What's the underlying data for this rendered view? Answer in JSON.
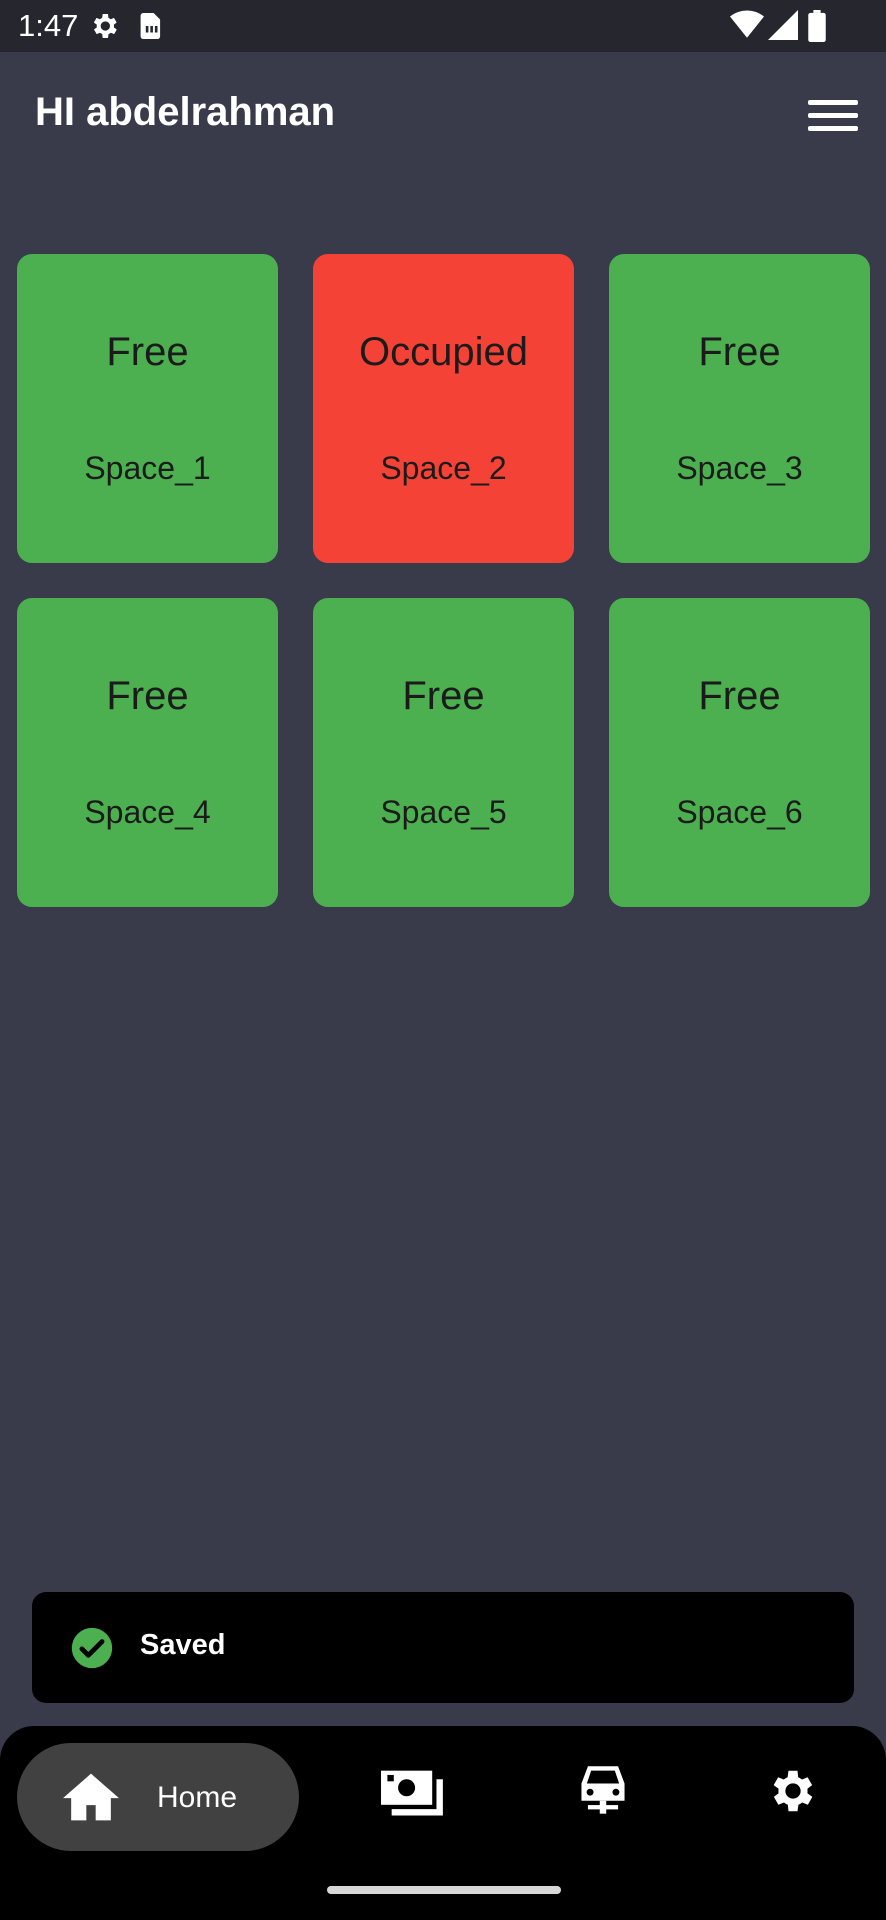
{
  "status_bar": {
    "time": "1:47",
    "icons": [
      "settings-gear-icon",
      "sim-card-icon",
      "wifi-icon",
      "cell-signal-icon",
      "battery-icon"
    ]
  },
  "header": {
    "greeting": "HI abdelrahman",
    "menu_icon": "hamburger-menu-icon"
  },
  "spaces": [
    {
      "status": "Free",
      "name": "Space_1",
      "color": "#4caf50"
    },
    {
      "status": "Occupied",
      "name": "Space_2",
      "color": "#f44336"
    },
    {
      "status": "Free",
      "name": "Space_3",
      "color": "#4caf50"
    },
    {
      "status": "Free",
      "name": "Space_4",
      "color": "#4caf50"
    },
    {
      "status": "Free",
      "name": "Space_5",
      "color": "#4caf50"
    },
    {
      "status": "Free",
      "name": "Space_6",
      "color": "#4caf50"
    }
  ],
  "snackbar": {
    "message": "Saved",
    "icon": "check-circle-icon",
    "icon_color": "#4caf50"
  },
  "bottom_nav": {
    "items": [
      {
        "label": "Home",
        "icon": "home-icon",
        "selected": true
      },
      {
        "icon": "payments-icon"
      },
      {
        "icon": "car-icon"
      },
      {
        "icon": "settings-icon"
      }
    ]
  },
  "colors": {
    "background": "#393b4a",
    "status_bar": "#25262e",
    "free": "#4caf50",
    "occupied": "#f44336"
  }
}
